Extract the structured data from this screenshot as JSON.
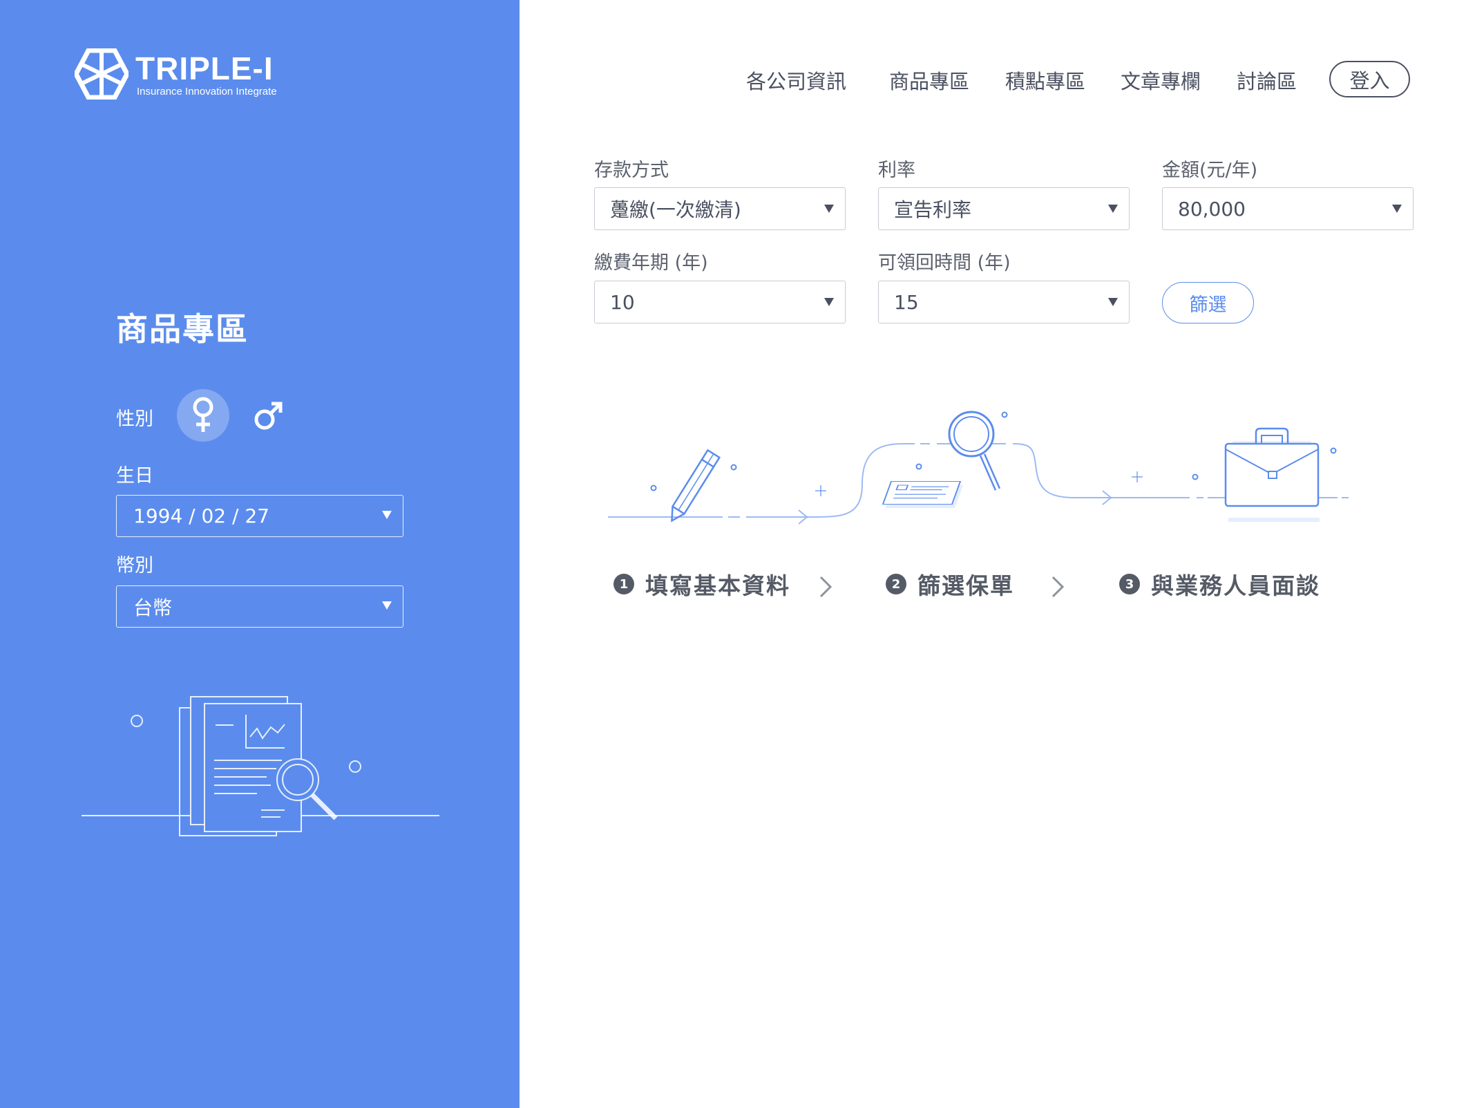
{
  "brand": {
    "name": "TRIPLE-I",
    "tagline": "Insurance Innovation Integrate",
    "colors": {
      "primary": "#5b8ced",
      "text": "#555b66",
      "white": "#ffffff"
    }
  },
  "nav": {
    "items": [
      "各公司資訊",
      "商品專區",
      "積點專區",
      "文章專欄",
      "討論區"
    ],
    "login_label": "登入"
  },
  "sidebar": {
    "title": "商品專區",
    "gender_label": "性別",
    "gender_selected": "female",
    "birthday_label": "生日",
    "birthday_value": "1994 / 02 / 27",
    "currency_label": "幣別",
    "currency_value": "台幣"
  },
  "filters": {
    "deposit_method": {
      "label": "存款方式",
      "value": "躉繳(一次繳清)"
    },
    "interest_rate": {
      "label": "利率",
      "value": "宣告利率"
    },
    "amount": {
      "label": "金額(元/年)",
      "value": "80,000"
    },
    "payment_years": {
      "label": "繳費年期 (年)",
      "value": "10"
    },
    "payout_time": {
      "label": "可領回時間 (年)",
      "value": "15"
    },
    "filter_button": "篩選"
  },
  "steps": [
    {
      "num": "1",
      "label": "填寫基本資料",
      "icon": "pencil-icon"
    },
    {
      "num": "2",
      "label": "篩選保單",
      "icon": "magnifier-icon"
    },
    {
      "num": "3",
      "label": "與業務人員面談",
      "icon": "briefcase-icon"
    }
  ]
}
